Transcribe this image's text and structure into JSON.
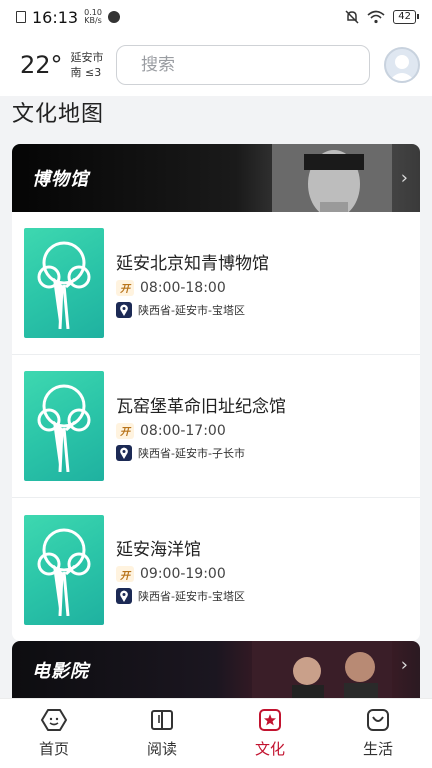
{
  "status_bar": {
    "time": "16:13",
    "net_speed_value": "0.10",
    "net_speed_unit": "KB/s",
    "battery": "42"
  },
  "header": {
    "temperature": "22°",
    "city": "延安市",
    "wind": "南 ≤3",
    "search_placeholder": "搜索"
  },
  "page_title": "文化地图",
  "sections": [
    {
      "title": "博物馆",
      "items": [
        {
          "name": "延安北京知青博物馆",
          "hours": "08:00-18:00",
          "address": "陕西省-延安市-宝塔区"
        },
        {
          "name": "瓦窑堡革命旧址纪念馆",
          "hours": "08:00-17:00",
          "address": "陕西省-延安市-子长市"
        },
        {
          "name": "延安海洋馆",
          "hours": "09:00-19:00",
          "address": "陕西省-延安市-宝塔区"
        }
      ]
    },
    {
      "title": "电影院"
    }
  ],
  "tabbar": {
    "tabs": [
      {
        "label": "首页",
        "icon": "home-hexagon-icon"
      },
      {
        "label": "阅读",
        "icon": "book-icon"
      },
      {
        "label": "文化",
        "icon": "culture-star-icon"
      },
      {
        "label": "生活",
        "icon": "bag-smile-icon"
      }
    ],
    "active_index": 2
  },
  "colors": {
    "accent": "#c2132f",
    "thumb_teal": "#2bc5a8",
    "pin_navy": "#1c2a55",
    "banner_dark": "#050505"
  },
  "open_tag_glyph": "开"
}
